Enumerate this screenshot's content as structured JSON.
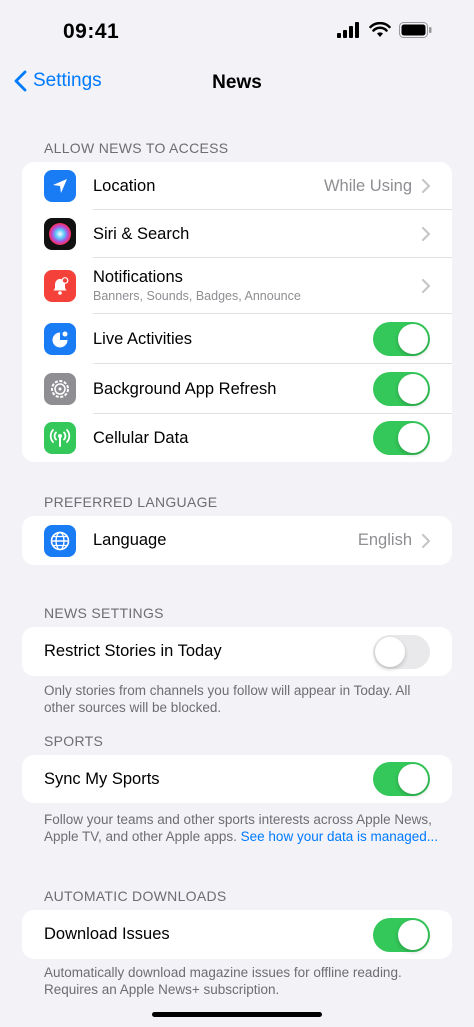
{
  "status_bar": {
    "time": "09:41"
  },
  "nav": {
    "back_label": "Settings",
    "title": "News"
  },
  "sections": {
    "access": {
      "header": "ALLOW NEWS TO ACCESS",
      "location": {
        "label": "Location",
        "value": "While Using",
        "icon": "location-arrow-icon",
        "color": "#1a7cf4"
      },
      "siri": {
        "label": "Siri & Search",
        "icon": "siri-icon"
      },
      "notifications": {
        "label": "Notifications",
        "sublabel": "Banners, Sounds, Badges, Announce",
        "icon": "bell-icon",
        "color": "#f4413a"
      },
      "live_activities": {
        "label": "Live Activities",
        "on": true,
        "icon": "live-activities-icon",
        "color": "#1a7cf4"
      },
      "background_refresh": {
        "label": "Background App Refresh",
        "on": true,
        "icon": "gear-icon",
        "color": "#8e8e93"
      },
      "cellular": {
        "label": "Cellular Data",
        "on": true,
        "icon": "antenna-icon",
        "color": "#34c759"
      }
    },
    "language": {
      "header": "PREFERRED LANGUAGE",
      "language": {
        "label": "Language",
        "value": "English",
        "icon": "globe-icon",
        "color": "#1a7cf4"
      }
    },
    "news_settings": {
      "header": "NEWS SETTINGS",
      "restrict": {
        "label": "Restrict Stories in Today",
        "on": false
      },
      "footer": "Only stories from channels you follow will appear in Today. All other sources will be blocked."
    },
    "sports": {
      "header": "SPORTS",
      "sync": {
        "label": "Sync My Sports",
        "on": true
      },
      "footer_text": "Follow your teams and other sports interests across Apple News, Apple TV, and other Apple apps. ",
      "footer_link": "See how your data is managed..."
    },
    "downloads": {
      "header": "AUTOMATIC DOWNLOADS",
      "download_issues": {
        "label": "Download Issues",
        "on": true
      },
      "footer": "Automatically download magazine issues for offline reading. Requires an Apple News+ subscription."
    }
  }
}
